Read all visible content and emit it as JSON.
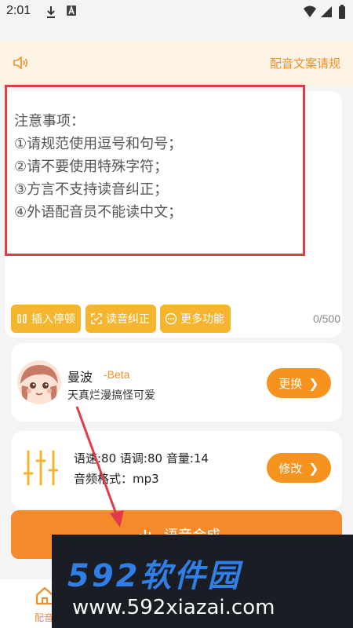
{
  "status_bar": {
    "time": "2:01"
  },
  "notice": {
    "link_label": "配音文案请规"
  },
  "editor": {
    "notes": [
      "注意事项：",
      "①请规范使用逗号和句号；",
      "②请不要使用特殊字符；",
      "③方言不支持读音纠正；",
      "④外语配音员不能读中文；"
    ],
    "tools": [
      "插入停顿",
      "读音纠正",
      "更多功能"
    ],
    "counter": "0/500"
  },
  "voice": {
    "name": "曼波",
    "tag": "-Beta",
    "description": "天真烂漫搞怪可爱",
    "change_label": "更换"
  },
  "settings": {
    "params": "语速:80 语调:80 音量:14",
    "format": "音频格式：mp3",
    "edit_label": "修改"
  },
  "synth": {
    "label": "语音合成"
  },
  "nav": {
    "home_label": "配音"
  },
  "watermark": {
    "logo": "592软件园",
    "url": "www.592xiazai.com"
  },
  "colors": {
    "accent": "#f6921e",
    "annotation": "#d8404c"
  }
}
